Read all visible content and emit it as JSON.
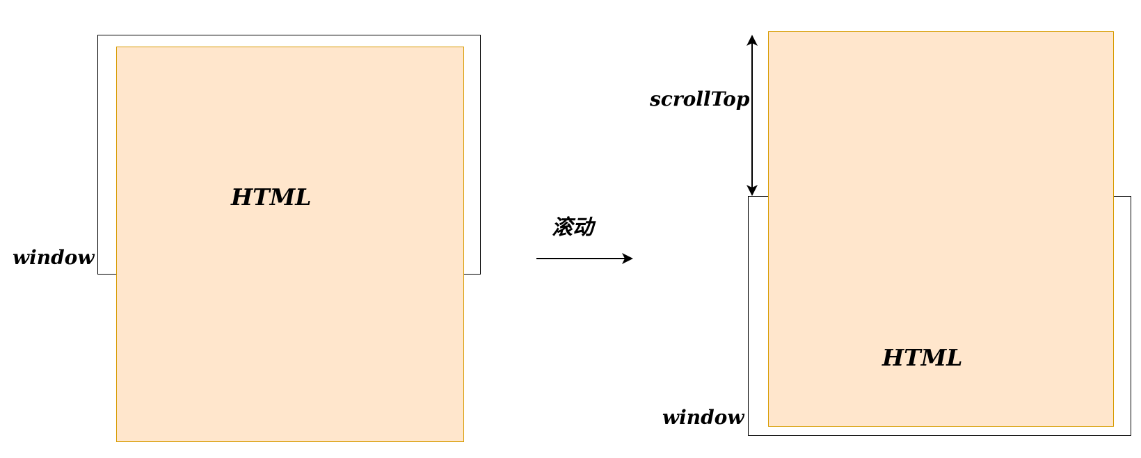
{
  "colors": {
    "html_fill": "#ffe6cc",
    "html_stroke": "#d79b00",
    "window_stroke": "#000000",
    "arrow": "#000000"
  },
  "before": {
    "html_label": "HTML",
    "window_label": "window"
  },
  "transition": {
    "label": "滚动"
  },
  "after": {
    "html_label": "HTML",
    "window_label": "window",
    "scroll_label": "scrollTop"
  }
}
